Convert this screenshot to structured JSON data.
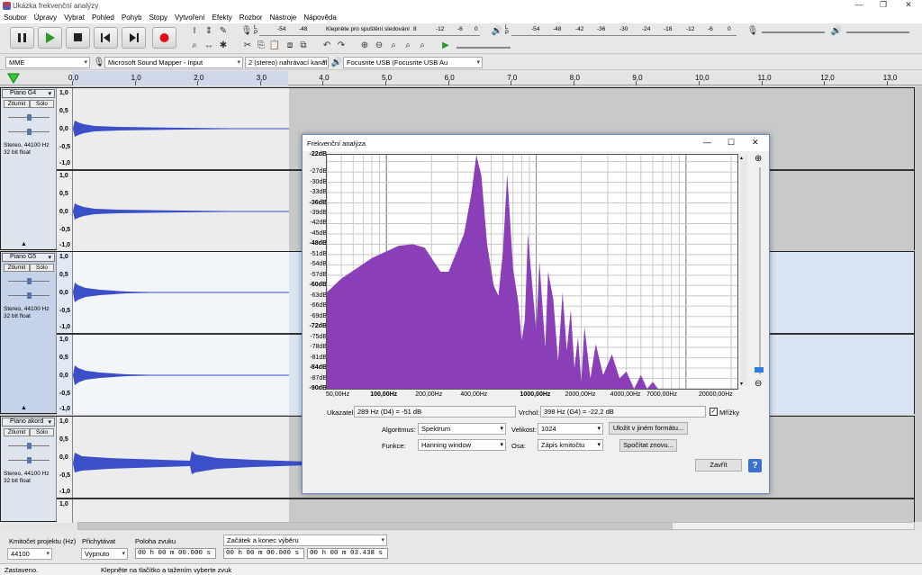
{
  "window": {
    "title": "Ukázka frekvenční analýzy",
    "minimize": "—",
    "restore": "❐",
    "close": "✕"
  },
  "menu": [
    "Soubor",
    "Úpravy",
    "Vybrat",
    "Pohled",
    "Pohyb",
    "Stopy",
    "Vytvoření",
    "Efekty",
    "Rozbor",
    "Nástroje",
    "Nápověda"
  ],
  "toolbar": {
    "meter_hint": "Klepněte pro spuštění sledování",
    "rec_meter_ticks": [
      "-54",
      "-48",
      "8",
      "-12",
      "-6",
      "0"
    ],
    "play_meter_ticks": [
      "-54",
      "-48",
      "-42",
      "-36",
      "-30",
      "-24",
      "-18",
      "-12",
      "-6",
      "0"
    ],
    "lr": [
      "L",
      "P"
    ]
  },
  "devices": {
    "host": "MME",
    "input": "Microsoft Sound Mapper - Input",
    "channels": "2 (stereo) nahrávací kanál",
    "output": "Focusrite USB (Focusrite USB Au"
  },
  "ruler": [
    "0,0",
    "1,0",
    "2,0",
    "3,0",
    "4,0",
    "5,0",
    "6,0",
    "7,0",
    "8,0",
    "9,0",
    "10,0",
    "11,0",
    "12,0",
    "13,0"
  ],
  "tracks": [
    {
      "name": "Piano G4",
      "mute": "Ztlumit",
      "solo": "Sólo",
      "info1": "Stereo, 44100 Hz",
      "info2": "32 bit float",
      "scale": [
        "1,0",
        "0,5",
        "0,0",
        "-0,5",
        "-1,0"
      ]
    },
    {
      "name": "Piano G5",
      "mute": "Ztlumit",
      "solo": "Sólo",
      "info1": "Stereo, 44100 Hz",
      "info2": "32 bit float",
      "scale": [
        "1,0",
        "0,5",
        "0,0",
        "-0,5",
        "-1,0"
      ]
    },
    {
      "name": "Piano akord",
      "mute": "Ztlumit",
      "solo": "Sólo",
      "info1": "Stereo, 44100 Hz",
      "info2": "32 bit float",
      "scale": [
        "1,0",
        "0,5",
        "0,0",
        "-0,5",
        "-1,0"
      ]
    }
  ],
  "gain_labels": [
    "-",
    "+",
    "L",
    "P"
  ],
  "selection": {
    "rate_label": "Kmitočet projektu (Hz)",
    "rate": "44100",
    "snap_label": "Přichytávat",
    "snap": "Vypnuto",
    "pos_label": "Poloha zvuku",
    "pos": "00 h 00 m 00.000 s",
    "range_label": "Začátek a konec výběru",
    "start": "00 h 00 m 00.000 s",
    "end": "00 h 00 m 03.438 s"
  },
  "status": {
    "state": "Zastaveno.",
    "hint": "Klepněte na tlačítko a tažením vyberte zvuk"
  },
  "dialog": {
    "title": "Frekvenční analýza",
    "ylabels": [
      "-22dB",
      "-27dB",
      "-30dB",
      "-33dB",
      "-36dB",
      "-39dB",
      "-42dB",
      "-45dB",
      "-48dB",
      "-51dB",
      "-54dB",
      "-57dB",
      "-60dB",
      "-63dB",
      "-66dB",
      "-69dB",
      "-72dB",
      "-75dB",
      "-78dB",
      "-81dB",
      "-84dB",
      "-87dB",
      "-90dB"
    ],
    "xlabels": [
      "50,00Hz",
      "100,00Hz",
      "200,00Hz",
      "400,00Hz",
      "1000,00Hz",
      "2000,00Hz",
      "4000,00Hz",
      "7000,00Hz",
      "20000,00Hz"
    ],
    "cursor_label": "Ukazatel:",
    "cursor": "289 Hz (D4) = -51 dB",
    "peak_label": "Vrchol:",
    "peak": "398 Hz (G4) = -22,2 dB",
    "grid_label": "Mřížky",
    "algo_label": "Algoritmus:",
    "algo": "Spektrum",
    "size_label": "Velikost:",
    "size": "1024",
    "func_label": "Funkce:",
    "func": "Hanning window",
    "axis_label": "Osa:",
    "axis": "Zápis kmitočtu",
    "export": "Uložit v jiném formátu...",
    "replot": "Spočítat znovu...",
    "close": "Zavřít",
    "help": "?",
    "colors": {
      "fill": "#8a3fb8",
      "accent": "#2f5fbf"
    }
  },
  "chart_data": {
    "type": "area",
    "xlabel": "",
    "ylabel": "",
    "x_scale": "log",
    "xlim": [
      40,
      22050
    ],
    "ylim": [
      -90,
      -22
    ],
    "grid": true,
    "x": [
      40,
      50,
      80,
      120,
      150,
      180,
      200,
      230,
      260,
      289,
      330,
      370,
      398,
      430,
      470,
      520,
      560,
      600,
      640,
      700,
      760,
      800,
      840,
      880,
      950,
      1000,
      1050,
      1150,
      1200,
      1300,
      1400,
      1500,
      1600,
      1700,
      1800,
      1900,
      2000,
      2100,
      2300,
      2500,
      2800,
      3200,
      3600,
      4000,
      4500,
      5000,
      5500,
      6000,
      6500
    ],
    "y": [
      -62,
      -58,
      -52,
      -48.5,
      -48,
      -49,
      -52,
      -56,
      -56,
      -51,
      -45,
      -33,
      -22.2,
      -28,
      -48,
      -60,
      -63,
      -50,
      -27.5,
      -55,
      -65,
      -76,
      -70,
      -45,
      -62,
      -73,
      -53,
      -78,
      -56,
      -64,
      -82,
      -62,
      -79,
      -67,
      -84,
      -75,
      -88,
      -72,
      -87,
      -77,
      -86,
      -80,
      -87,
      -85,
      -90,
      -86,
      -90,
      -88,
      -90
    ]
  }
}
